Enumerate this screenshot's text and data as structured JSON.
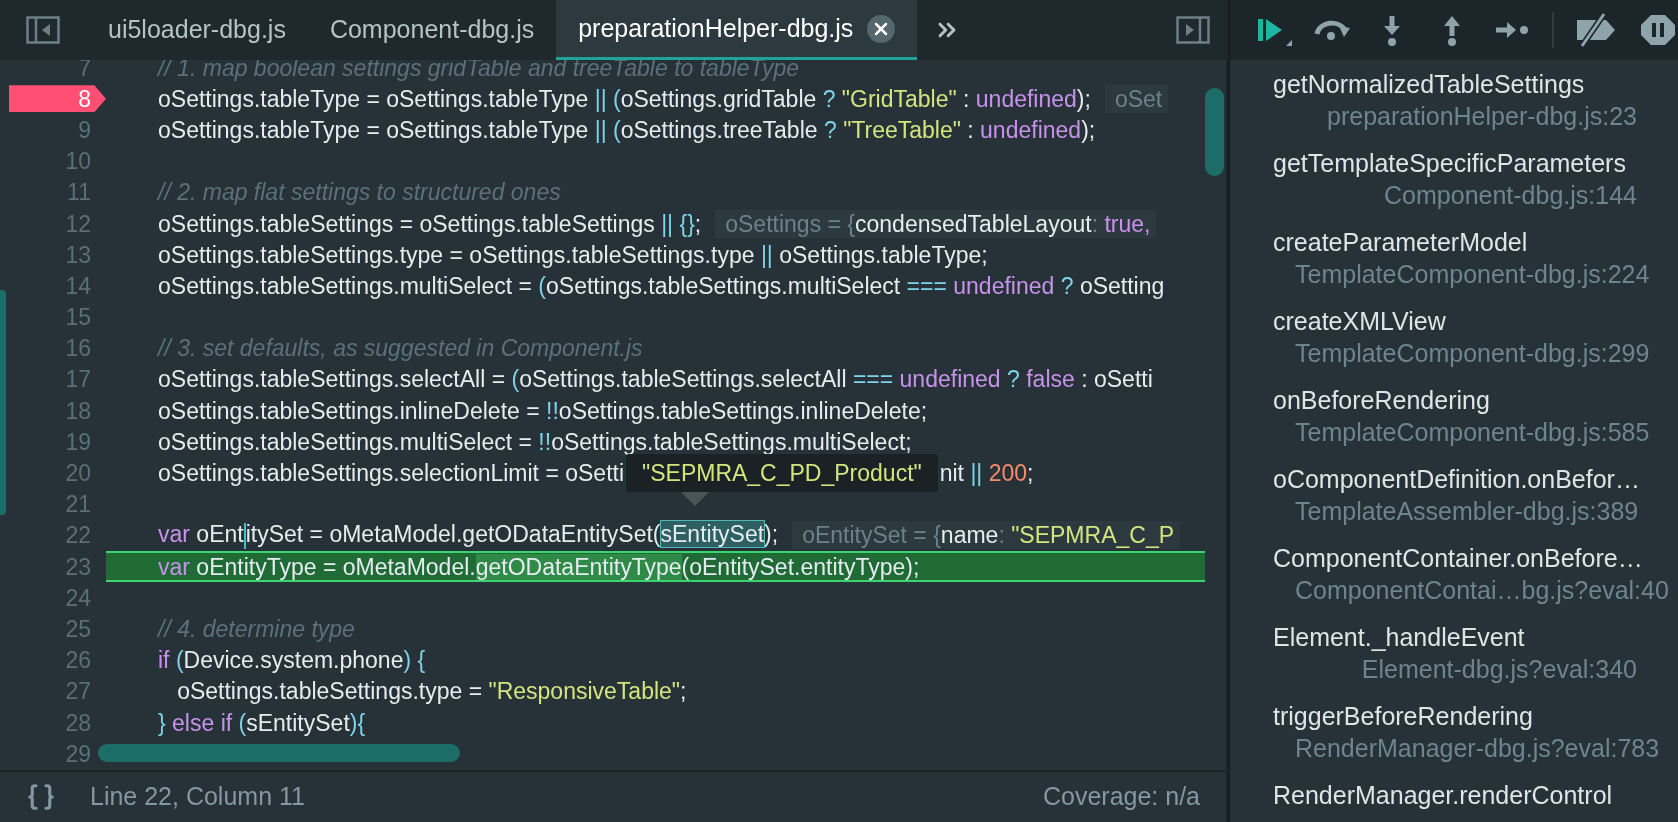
{
  "tabs": [
    {
      "label": "ui5loader-dbg.js",
      "selected": false
    },
    {
      "label": "Component-dbg.js",
      "selected": false
    },
    {
      "label": "preparationHelper-dbg.js",
      "selected": true
    }
  ],
  "code_lines": [
    {
      "number": "7",
      "breakpoint": false,
      "current": false,
      "segments": [
        {
          "kind": "comment",
          "text": "// 1. map boolean settings gridTable and treeTable to tableType"
        }
      ]
    },
    {
      "number": "8",
      "breakpoint": true,
      "current": false,
      "segments": [
        {
          "kind": "plain",
          "text": "oSettings.tableType = oSettings.tableType "
        },
        {
          "kind": "punct",
          "text": "|| ("
        },
        {
          "kind": "plain",
          "text": "oSettings.gridTable "
        },
        {
          "kind": "punct",
          "text": "? "
        },
        {
          "kind": "string",
          "text": "\"GridTable\""
        },
        {
          "kind": "plain",
          "text": " : "
        },
        {
          "kind": "keyword",
          "text": "undefined"
        },
        {
          "kind": "plain",
          "text": ");"
        }
      ],
      "inline_value": [
        {
          "kind": "hint",
          "text": "oSet"
        }
      ]
    },
    {
      "number": "9",
      "breakpoint": false,
      "current": false,
      "segments": [
        {
          "kind": "plain",
          "text": "oSettings.tableType = oSettings.tableType "
        },
        {
          "kind": "punct",
          "text": "|| ("
        },
        {
          "kind": "plain",
          "text": "oSettings.treeTable "
        },
        {
          "kind": "punct",
          "text": "? "
        },
        {
          "kind": "string",
          "text": "\"TreeTable\""
        },
        {
          "kind": "plain",
          "text": " : "
        },
        {
          "kind": "keyword",
          "text": "undefined"
        },
        {
          "kind": "plain",
          "text": ");"
        }
      ]
    },
    {
      "number": "10",
      "breakpoint": false,
      "current": false
    },
    {
      "number": "11",
      "breakpoint": false,
      "current": false,
      "segments": [
        {
          "kind": "comment",
          "text": "// 2. map flat settings to structured ones"
        }
      ]
    },
    {
      "number": "12",
      "breakpoint": false,
      "current": false,
      "segments": [
        {
          "kind": "plain",
          "text": "oSettings.tableSettings = oSettings.tableSettings "
        },
        {
          "kind": "punct",
          "text": "|| {}"
        },
        {
          "kind": "plain",
          "text": ";"
        }
      ],
      "inline_value": [
        {
          "kind": "hint",
          "text": "oSettings = {"
        },
        {
          "kind": "plain",
          "text": "condensedTableLayout"
        },
        {
          "kind": "hint",
          "text": ": "
        },
        {
          "kind": "keyword",
          "text": "true,"
        }
      ]
    },
    {
      "number": "13",
      "breakpoint": false,
      "current": false,
      "segments": [
        {
          "kind": "plain",
          "text": "oSettings.tableSettings.type = oSettings.tableSettings.type "
        },
        {
          "kind": "punct",
          "text": "||"
        },
        {
          "kind": "plain",
          "text": " oSettings.tableType;"
        }
      ]
    },
    {
      "number": "14",
      "breakpoint": false,
      "current": false,
      "segments": [
        {
          "kind": "plain",
          "text": "oSettings.tableSettings.multiSelect = "
        },
        {
          "kind": "punct",
          "text": "("
        },
        {
          "kind": "plain",
          "text": "oSettings.tableSettings.multiSelect "
        },
        {
          "kind": "punct",
          "text": "==="
        },
        {
          "kind": "keyword",
          "text": " undefined"
        },
        {
          "kind": "punct",
          "text": " ?"
        },
        {
          "kind": "plain",
          "text": " oSetting"
        }
      ]
    },
    {
      "number": "15",
      "breakpoint": false,
      "current": false
    },
    {
      "number": "16",
      "breakpoint": false,
      "current": false,
      "segments": [
        {
          "kind": "comment",
          "text": "// 3. set defaults, as suggested in Component.js"
        }
      ]
    },
    {
      "number": "17",
      "breakpoint": false,
      "current": false,
      "segments": [
        {
          "kind": "plain",
          "text": "oSettings.tableSettings.selectAll = "
        },
        {
          "kind": "punct",
          "text": "("
        },
        {
          "kind": "plain",
          "text": "oSettings.tableSettings.selectAll "
        },
        {
          "kind": "punct",
          "text": "==="
        },
        {
          "kind": "keyword",
          "text": " undefined"
        },
        {
          "kind": "punct",
          "text": " ?"
        },
        {
          "kind": "keyword",
          "text": " false"
        },
        {
          "kind": "plain",
          "text": " : oSetti"
        }
      ]
    },
    {
      "number": "18",
      "breakpoint": false,
      "current": false,
      "segments": [
        {
          "kind": "plain",
          "text": "oSettings.tableSettings.inlineDelete = "
        },
        {
          "kind": "punct",
          "text": "!!"
        },
        {
          "kind": "plain",
          "text": "oSettings.tableSettings.inlineDelete;"
        }
      ]
    },
    {
      "number": "19",
      "breakpoint": false,
      "current": false,
      "segments": [
        {
          "kind": "plain",
          "text": "oSettings.tableSettings.multiSelect = "
        },
        {
          "kind": "punct",
          "text": "!!"
        },
        {
          "kind": "plain",
          "text": "oSettings.tableSettings.multiSelect;"
        }
      ]
    },
    {
      "number": "20",
      "breakpoint": false,
      "current": false,
      "segments": [
        {
          "kind": "plain",
          "text": "oSettings.tableSettings.selectionLimit = oSetti"
        }
      ],
      "tooltip": "\"SEPMRA_C_PD_Product\"",
      "segments_after_tooltip": [
        {
          "kind": "plain",
          "text": "nit "
        },
        {
          "kind": "punct",
          "text": "||"
        },
        {
          "kind": "number",
          "text": " 200"
        },
        {
          "kind": "plain",
          "text": ";"
        }
      ]
    },
    {
      "number": "21",
      "breakpoint": false,
      "current": false
    },
    {
      "number": "22",
      "breakpoint": false,
      "current": false,
      "segments": [
        {
          "kind": "keyword",
          "text": "var "
        },
        {
          "kind": "plain",
          "text": "oEnt",
          "caret_after": true
        },
        {
          "kind": "plain",
          "text": "itySet = oMetaModel.getODataEntitySet("
        },
        {
          "kind": "hover",
          "text": "sEntitySet"
        },
        {
          "kind": "plain",
          "text": ");"
        }
      ],
      "inline_value": [
        {
          "kind": "hint",
          "text": "oEntitySet = {"
        },
        {
          "kind": "plain",
          "text": "name"
        },
        {
          "kind": "hint",
          "text": ": "
        },
        {
          "kind": "string",
          "text": "\"SEPMRA_C_P"
        }
      ]
    },
    {
      "number": "23",
      "breakpoint": false,
      "current": true,
      "segments": [
        {
          "kind": "keyword",
          "text": "var "
        },
        {
          "kind": "plain",
          "text": "oEntityType = oMetaModel."
        },
        {
          "kind": "call",
          "text": "getODataEntityType"
        },
        {
          "kind": "plain",
          "text": "(oEntitySet.entityType);"
        }
      ]
    },
    {
      "number": "24",
      "breakpoint": false,
      "current": false
    },
    {
      "number": "25",
      "breakpoint": false,
      "current": false,
      "segments": [
        {
          "kind": "comment",
          "text": "// 4. determine type"
        }
      ]
    },
    {
      "number": "26",
      "breakpoint": false,
      "current": false,
      "segments": [
        {
          "kind": "keyword",
          "text": "if "
        },
        {
          "kind": "punct",
          "text": "("
        },
        {
          "kind": "plain",
          "text": "Device.system.phone"
        },
        {
          "kind": "punct",
          "text": ") {"
        }
      ]
    },
    {
      "number": "27",
      "breakpoint": false,
      "current": false,
      "segments": [
        {
          "kind": "plain",
          "text": "   oSettings.tableSettings.type = "
        },
        {
          "kind": "string",
          "text": "\"ResponsiveTable\""
        },
        {
          "kind": "plain",
          "text": ";"
        }
      ]
    },
    {
      "number": "28",
      "breakpoint": false,
      "current": false,
      "segments": [
        {
          "kind": "punct",
          "text": "} "
        },
        {
          "kind": "keyword",
          "text": "else if "
        },
        {
          "kind": "punct",
          "text": "("
        },
        {
          "kind": "plain",
          "text": "sEntitySet"
        },
        {
          "kind": "punct",
          "text": "){"
        }
      ]
    },
    {
      "number": "29",
      "breakpoint": false,
      "current": false
    }
  ],
  "status_bar": {
    "position": "Line 22, Column 11",
    "coverage": "Coverage: n/a"
  },
  "call_stack": [
    {
      "function": "getNormalizedTableSettings",
      "location": "preparationHelper-dbg.js:23"
    },
    {
      "function": "getTemplateSpecificParameters",
      "location": "Component-dbg.js:144"
    },
    {
      "function": "createParameterModel",
      "location": "TemplateComponent-dbg.js:224"
    },
    {
      "function": "createXMLView",
      "location": "TemplateComponent-dbg.js:299"
    },
    {
      "function": "onBeforeRendering",
      "location": "TemplateComponent-dbg.js:585"
    },
    {
      "function": "oComponentDefinition.onBefor…",
      "location": "TemplateAssembler-dbg.js:389"
    },
    {
      "function": "ComponentContainer.onBefore…",
      "location": "ComponentContai…bg.js?eval:40"
    },
    {
      "function": "Element._handleEvent",
      "location": "Element-dbg.js?eval:340"
    },
    {
      "function": "triggerBeforeRendering",
      "location": "RenderManager-dbg.js?eval:783"
    },
    {
      "function": "RenderManager.renderControl"
    }
  ]
}
